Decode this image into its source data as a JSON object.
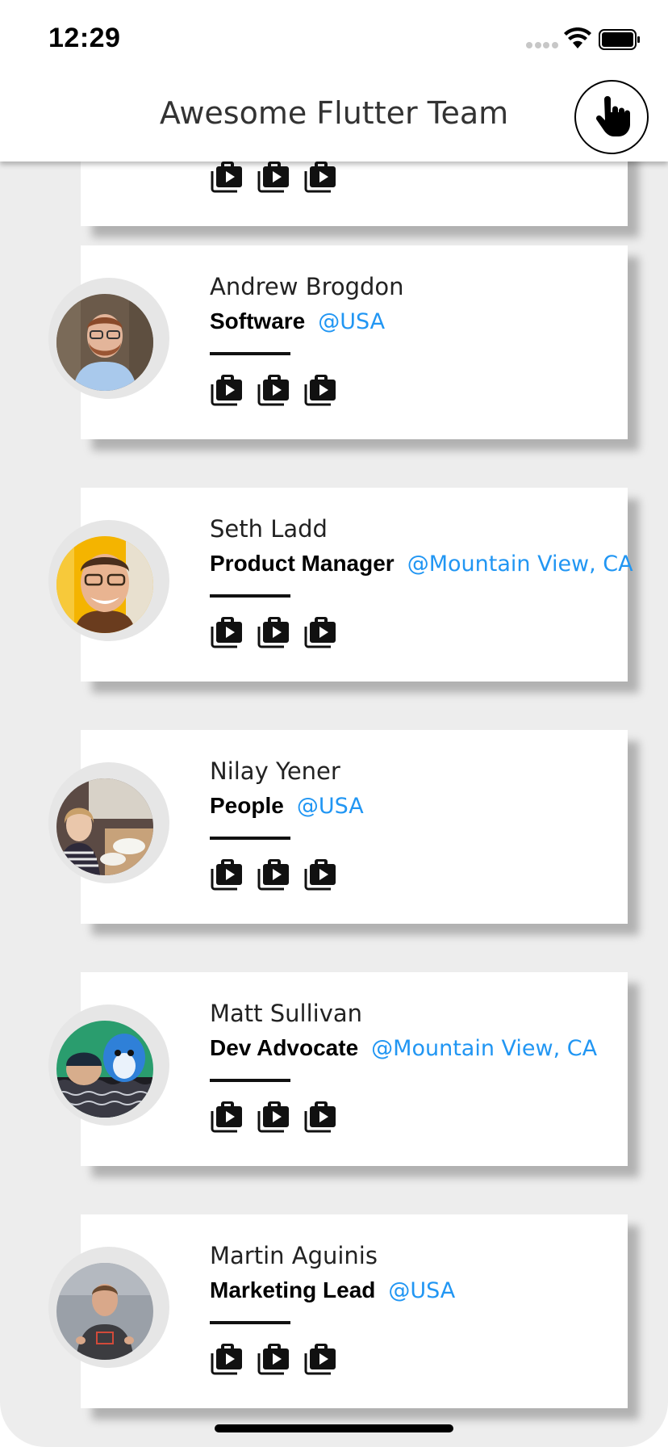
{
  "status_bar": {
    "time": "12:29"
  },
  "app_bar": {
    "title": "Awesome Flutter Team"
  },
  "colors": {
    "accent": "#2196f3",
    "background": "#ededed",
    "card": "#ffffff",
    "text": "#222222"
  },
  "members": [
    {
      "name": "Andrew Brogdon",
      "role": "Software",
      "location": "@USA",
      "avatar": "person-avatar-glasses-beard"
    },
    {
      "name": "Seth Ladd",
      "role": "Product Manager",
      "location": "@Mountain View, CA",
      "avatar": "person-avatar-glasses-smile"
    },
    {
      "name": "Nilay Yener",
      "role": "People",
      "location": "@USA",
      "avatar": "person-avatar-dining"
    },
    {
      "name": "Matt Sullivan",
      "role": "Dev Advocate",
      "location": "@Mountain View, CA",
      "avatar": "person-avatar-blue-bird"
    },
    {
      "name": "Martin Aguinis",
      "role": "Marketing Lead",
      "location": "@USA",
      "avatar": "person-avatar-presenting"
    }
  ],
  "card_icons": [
    "portfolio-video-icon",
    "portfolio-video-icon",
    "portfolio-video-icon"
  ]
}
